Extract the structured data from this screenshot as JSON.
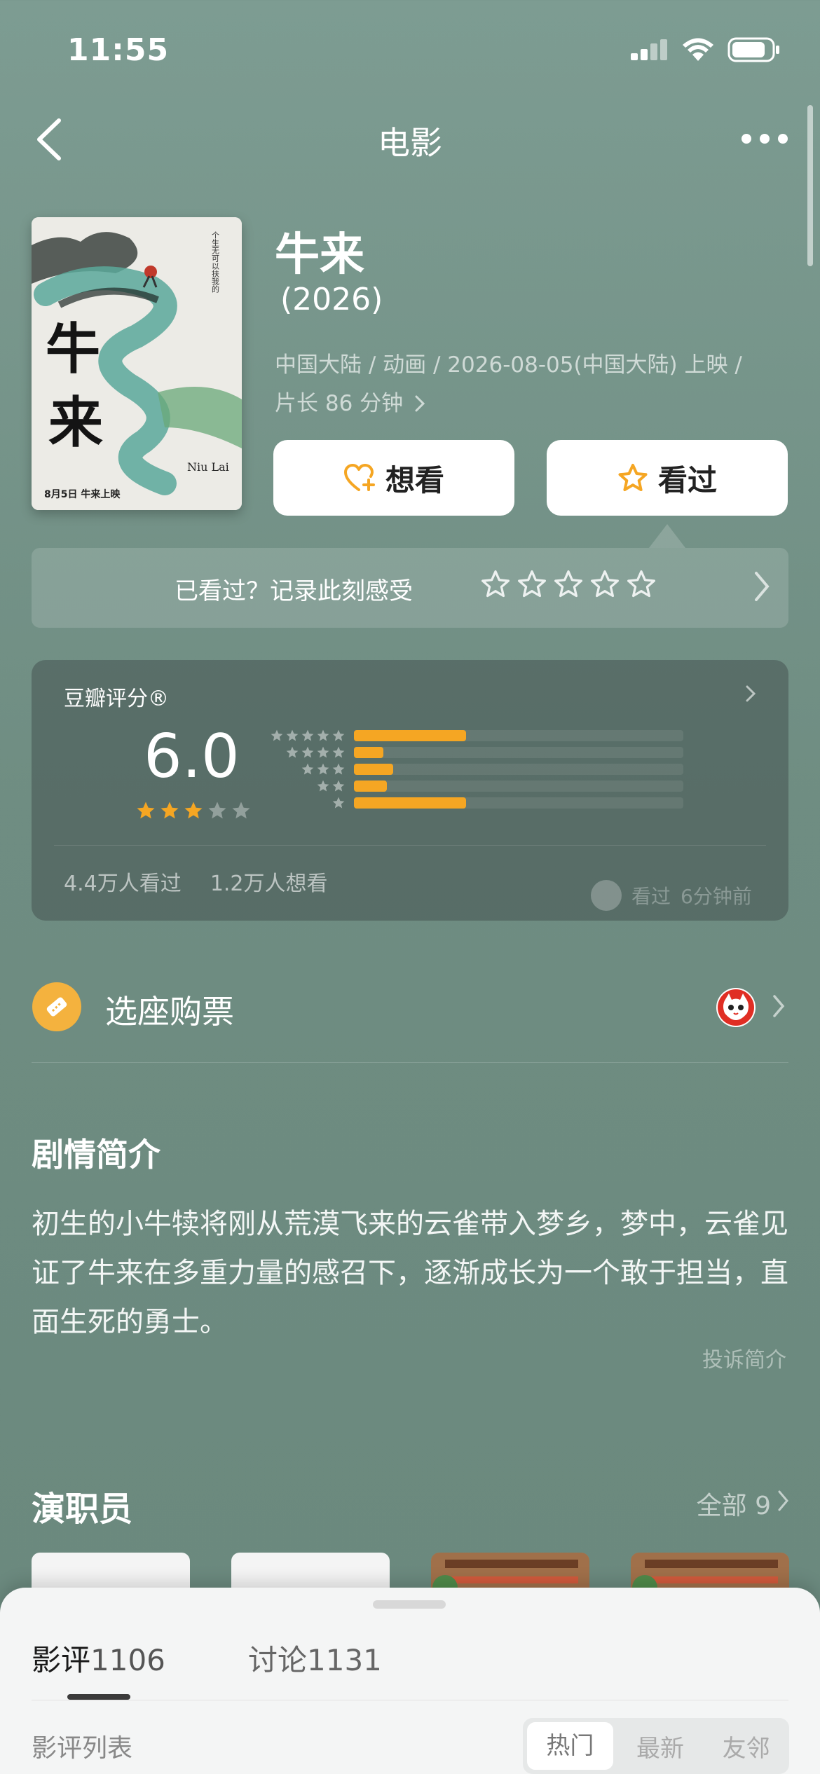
{
  "status_bar": {
    "time": "11:55"
  },
  "nav": {
    "title": "电影"
  },
  "movie": {
    "title": "牛来",
    "year": "(2026)",
    "meta_line1": "中国大陆 / 动画 / 2026-08-05(中国大陆) 上映 /",
    "meta_line2": "片长 86 分钟",
    "poster": {
      "vertical_title": "牛来",
      "english": "Niu Lai",
      "date_line": "8月5日 牛来上映",
      "side_text": "个生无可以扶我的 在梦里"
    }
  },
  "actions": {
    "want_label": "想看",
    "seen_label": "看过"
  },
  "record": {
    "text": "已看过？记录此刻感受",
    "star_count": 5
  },
  "rating": {
    "label": "豆瓣评分®",
    "score": "6.0",
    "stars_filled": 3,
    "stars_total": 5,
    "distribution_percent": [
      34,
      9,
      12,
      10,
      34
    ],
    "seen_count": "4.4万人看过",
    "want_count": "1.2万人想看",
    "friend_text": "看过",
    "friend_time": "6分钟前",
    "accent_color": "#f5a623"
  },
  "ticket": {
    "label": "选座购票"
  },
  "synopsis": {
    "heading": "剧情简介",
    "text": "初生的小牛犊将刚从荒漠飞来的云雀带入梦乡，梦中，云雀见证了牛来在多重力量的感召下，逐渐成长为一个敢于担当，直面生死的勇士。",
    "report": "投诉简介"
  },
  "cast": {
    "heading": "演职员",
    "all_label": "全部 9"
  },
  "sheet": {
    "tab_reviews": "影评",
    "tab_reviews_count": "1106",
    "tab_discuss": "讨论",
    "tab_discuss_count": "1131",
    "list_label": "影评列表",
    "sort_options": [
      "热门",
      "最新",
      "友邻"
    ],
    "sort_selected": "热门"
  }
}
